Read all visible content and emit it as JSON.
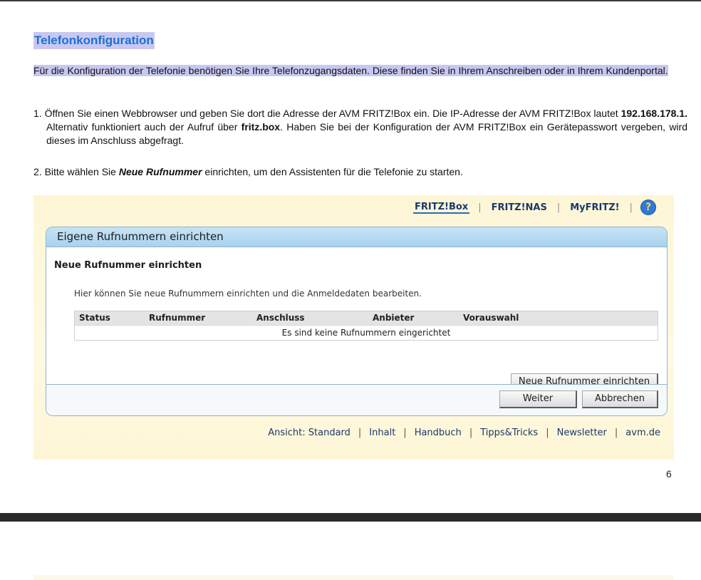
{
  "document": {
    "title": "Telefonkonfiguration",
    "intro": "Für die Konfiguration der Telefonie benötigen Sie Ihre Telefonzugangsdaten. Diese finden Sie in Ihrem Anschreiben oder in Ihrem Kundenportal.",
    "step1": {
      "prefix": "1. Öffnen Sie einen Webbrowser und geben Sie dort die Adresse der AVM FRITZ!Box ein. Die IP-Adresse der AVM FRITZ!Box lautet ",
      "ip": "192.168.178.1.",
      "middle": " Alternativ funktioniert auch der Aufruf über ",
      "host": "fritz.box",
      "suffix": ". Haben Sie bei der Konfiguration der AVM FRITZ!Box ein Gerätepasswort vergeben, wird dieses im Anschluss abgefragt."
    },
    "step2": {
      "prefix": "2. Bitte wählen Sie ",
      "emphasis": "Neue Rufnummer",
      "suffix": " einrichten, um den Assistenten für die Telefonie zu starten."
    },
    "page_number": "6"
  },
  "fritz": {
    "nav": [
      "FRITZ!Box",
      "FRITZ!NAS",
      "MyFRITZ!"
    ],
    "help": "?",
    "panel_title": "Eigene Rufnummern einrichten",
    "section_title": "Neue Rufnummer einrichten",
    "description": "Hier können Sie neue Rufnummern einrichten und die Anmeldedaten bearbeiten.",
    "table": {
      "headers": [
        "Status",
        "Rufnummer",
        "Anschluss",
        "Anbieter",
        "Vorauswahl"
      ],
      "empty_message": "Es sind keine Rufnummern eingerichtet"
    },
    "buttons": {
      "new_number": "Neue Rufnummer einrichten",
      "next": "Weiter",
      "cancel": "Abbrechen"
    },
    "footer_links": [
      "Ansicht: Standard",
      "Inhalt",
      "Handbuch",
      "Tipps&Tricks",
      "Newsletter",
      "avm.de"
    ]
  }
}
